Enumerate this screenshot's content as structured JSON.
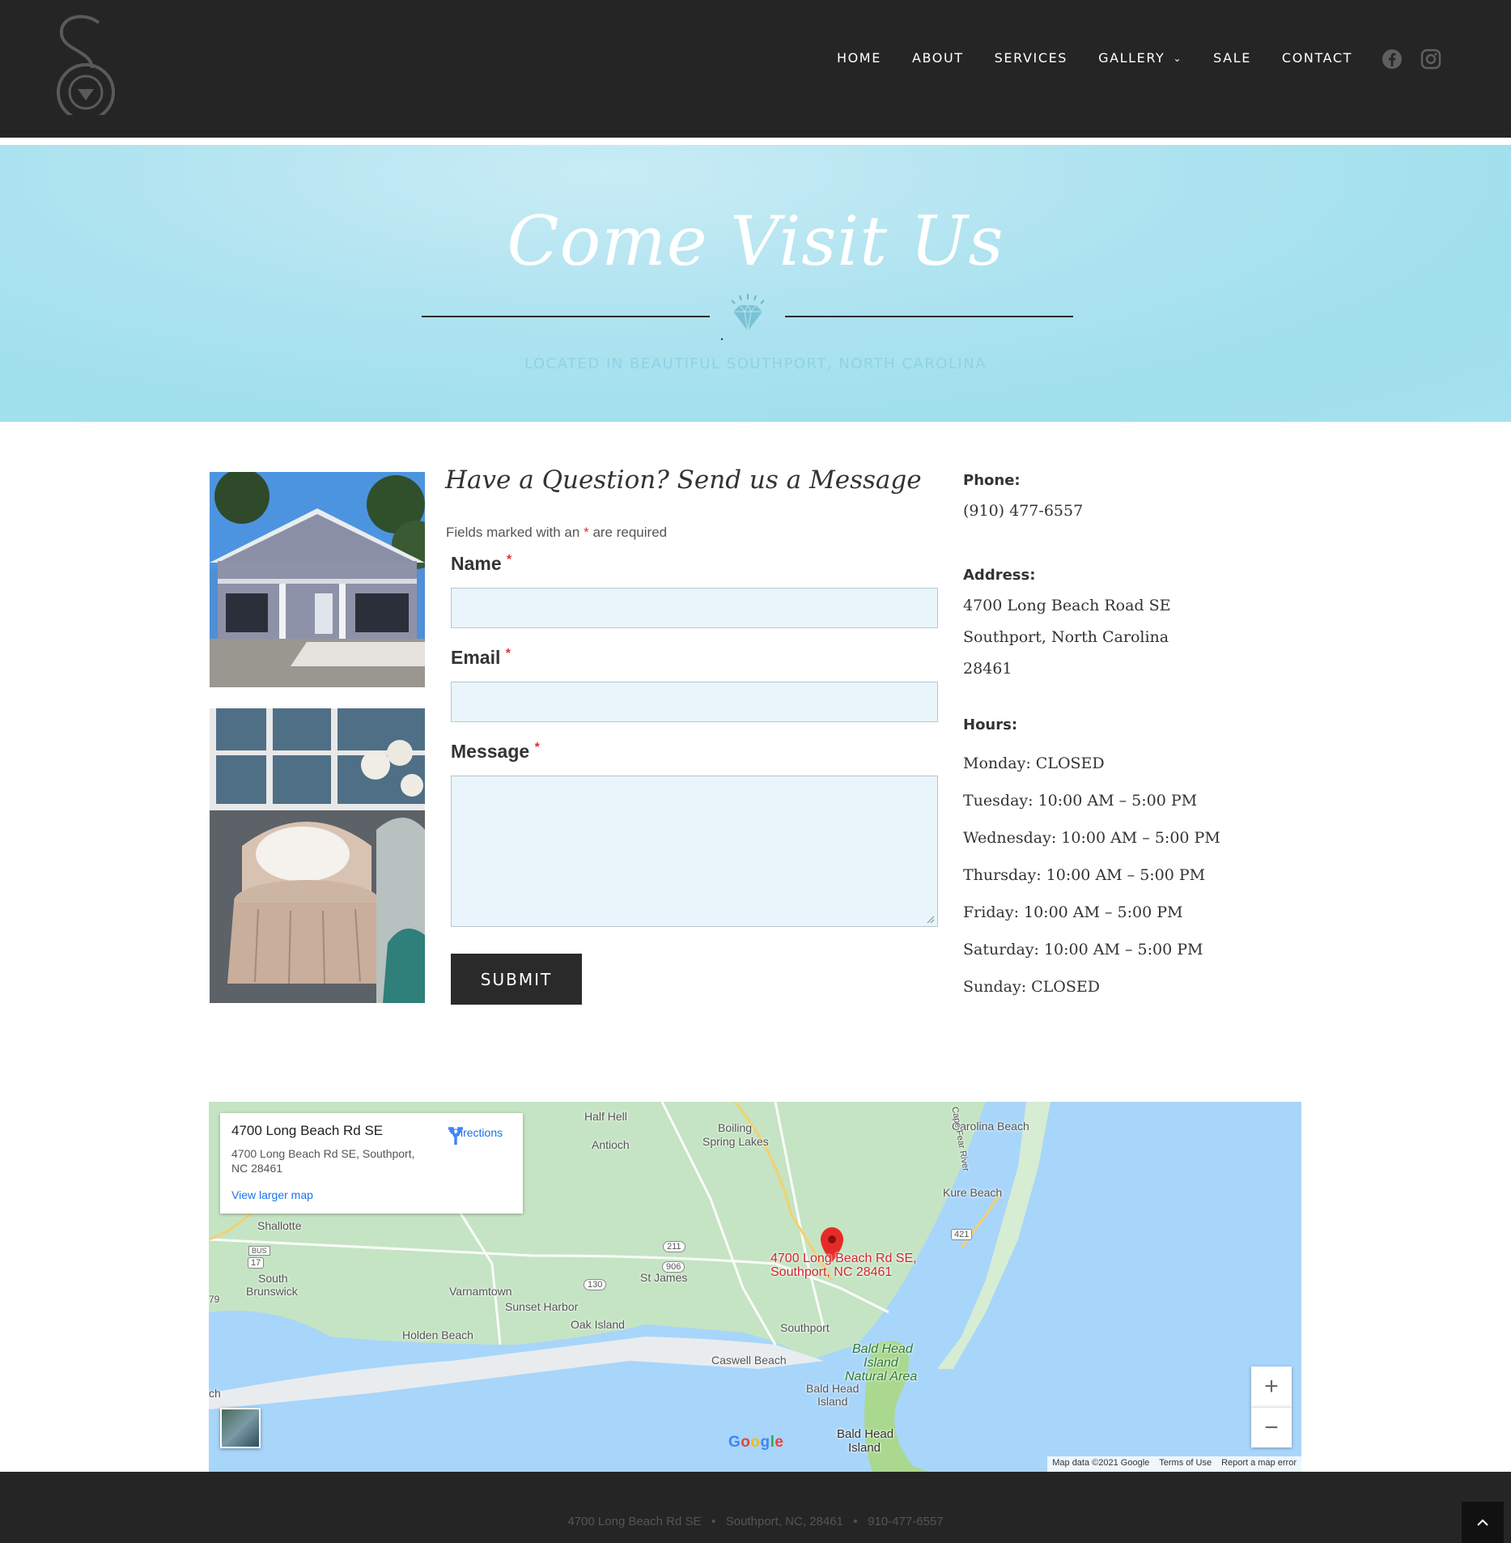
{
  "nav": {
    "home": "HOME",
    "about": "ABOUT",
    "services": "SERVICES",
    "gallery": "GALLERY",
    "sale": "SALE",
    "contact": "CONTACT"
  },
  "social": [
    "facebook-icon",
    "instagram-icon"
  ],
  "hero": {
    "title": "Come Visit Us",
    "subtitle": "LOCATED IN BEAUTIFUL SOUTHPORT, NORTH CAROLINA"
  },
  "form": {
    "title": "Have a Question? Send us a Message",
    "note_before": "Fields marked with an",
    "note_star": "*",
    "note_after": "are required",
    "name_label": "Name",
    "email_label": "Email",
    "message_label": "Message",
    "required_mark": "*",
    "submit": "SUBMIT"
  },
  "info": {
    "phone_heading": "Phone:",
    "phone": "(910) 477-6557",
    "address_heading": "Address:",
    "address_line1": "4700 Long Beach Road SE",
    "address_line2": "Southport, North Carolina",
    "address_line3": "28461",
    "hours_heading": "Hours:",
    "hours": [
      "Monday: CLOSED",
      "Tuesday: 10:00 AM – 5:00 PM",
      "Wednesday: 10:00 AM – 5:00 PM",
      "Thursday: 10:00 AM – 5:00 PM",
      "Friday: 10:00 AM – 5:00 PM",
      "Saturday: 10:00 AM – 5:00 PM",
      "Sunday: CLOSED"
    ]
  },
  "map": {
    "card_title": "4700 Long Beach Rd SE",
    "card_address": "4700 Long Beach Rd SE, Southport, NC 28461",
    "directions": "Directions",
    "larger_map": "View larger map",
    "pin_label_1": "4700 Long Beach Rd SE,",
    "pin_label_2": "Southport, NC 28461",
    "places": {
      "half_hell": "Half Hell",
      "antioch": "Antioch",
      "boiling_1": "Boiling",
      "boiling_2": "Spring Lakes",
      "carolina_beach": "Carolina Beach",
      "kure_beach": "Kure Beach",
      "cape_fear": "Cape Fear River",
      "shallotte": "Shallotte",
      "south_1": "South",
      "south_2": "Brunswick",
      "varnamtown": "Varnamtown",
      "st_james": "St James",
      "sunset_harbor": "Sunset Harbor",
      "oak_island": "Oak Island",
      "holden_beach": "Holden Beach",
      "southport": "Southport",
      "caswell_beach": "Caswell Beach",
      "bald_head_natural_1": "Bald Head",
      "bald_head_natural_2": "Island",
      "bald_head_natural_3": "Natural Area",
      "bald_head_a1": "Bald Head",
      "bald_head_a2": "Island",
      "bald_head_b1": "Bald Head",
      "bald_head_b2": "Island",
      "edge_79": "79",
      "edge_ch": "ch"
    },
    "routes": [
      "211",
      "906",
      "130",
      "17",
      "BUS",
      "421"
    ],
    "google": "Google",
    "attribution": [
      "Map data ©2021 Google",
      "Terms of Use",
      "Report a map error"
    ]
  },
  "footer": {
    "address": "4700 Long Beach Rd SE",
    "city": "Southport, NC, 28461",
    "phone": "910-477-6557",
    "separator": "•"
  },
  "colors": {
    "header_bg": "#252526",
    "hero_bg": "#a6e1ee",
    "field_bg": "#e9f5fb",
    "required": "#dd3333",
    "link": "#1a73e8"
  }
}
